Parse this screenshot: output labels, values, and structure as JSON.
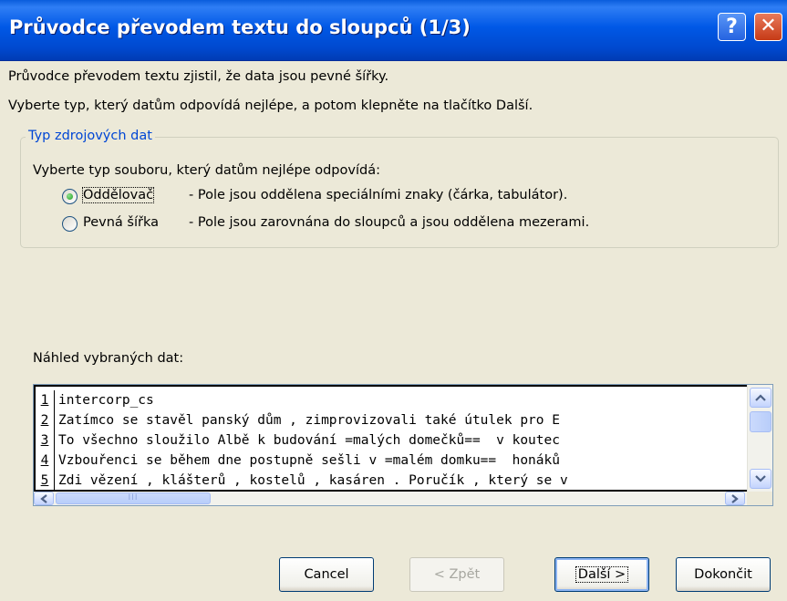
{
  "dialog": {
    "title": "Průvodce převodem textu do sloupců (1/3)",
    "help_symbol": "?",
    "close_symbol": "✕"
  },
  "intro": {
    "line1": "Průvodce převodem textu zjistil, že data jsou pevné šířky.",
    "line2": "Vyberte typ, který datům odpovídá nejlépe, a potom klepněte na tlačítko Další."
  },
  "source_type": {
    "group_label": "Typ zdrojových dat",
    "prompt": "Vyberte typ souboru, který datům nejlépe odpovídá:",
    "options": [
      {
        "label": "Oddělovač",
        "description": "- Pole jsou oddělena speciálními znaky (čárka, tabulátor).",
        "selected": true
      },
      {
        "label": "Pevná šířka",
        "description": "- Pole jsou zarovnána do sloupců a jsou oddělena mezerami.",
        "selected": false
      }
    ]
  },
  "preview": {
    "label": "Náhled vybraných dat:",
    "rows": [
      {
        "num": "1",
        "text": "intercorp_cs"
      },
      {
        "num": "2",
        "text": "Zatímco se stavěl panský dům , zimprovizovali také útulek pro E"
      },
      {
        "num": "3",
        "text": "To všechno sloužilo Albě k budování =malých domečků==  v koutec"
      },
      {
        "num": "4",
        "text": "Vzbouřenci se během dne postupně sešli v =malém domku==  honáků"
      },
      {
        "num": "5",
        "text": "Zdi vězení , klášterů , kostelů , kasáren . Poručík , který se v"
      }
    ],
    "hscroll_grip": "III"
  },
  "icons": {
    "scroll_up": "up-arrow-icon",
    "scroll_down": "down-arrow-icon",
    "scroll_left": "left-arrow-icon",
    "scroll_right": "right-arrow-icon"
  },
  "buttons": {
    "cancel": "Cancel",
    "back": "< Zpět",
    "next": "Další >",
    "finish": "Dokončit"
  },
  "colors": {
    "title_bar": "#0058e6",
    "dialog_bg": "#ece9d8",
    "group_label": "#0046d5",
    "close_button": "#c63a16"
  }
}
